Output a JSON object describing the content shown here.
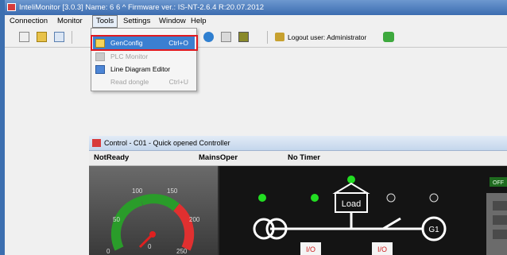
{
  "window": {
    "title": "InteliMonitor [3.0.3] Name: 6  6  ^   Firmware ver.: IS-NT-2.6.4 R:20.07.2012"
  },
  "menubar": {
    "items": [
      "Connection",
      "Monitor",
      "Tools",
      "Settings",
      "Window",
      "Help"
    ],
    "open_item": "Tools"
  },
  "toolbar": {
    "logout_label": "Logout user: Administrator"
  },
  "tools_menu": {
    "items": [
      {
        "label": "GenConfig",
        "shortcut": "Ctrl+O",
        "state": "highlighted",
        "icon": "genconfig-icon"
      },
      {
        "label": "PLC Monitor",
        "shortcut": "",
        "state": "disabled",
        "icon": "plc-monitor-icon"
      },
      {
        "label": "Line Diagram Editor",
        "shortcut": "",
        "state": "enabled",
        "icon": "line-diagram-icon"
      },
      {
        "label": "Read dongle",
        "shortcut": "Ctrl+U",
        "state": "disabled",
        "icon": ""
      }
    ]
  },
  "control_window": {
    "title": "Control - C01 - Quick opened Controller",
    "status": {
      "left": "NotReady",
      "middle": "MainsOper",
      "right": "No Timer"
    },
    "gauge": {
      "ticks": [
        "0",
        "50",
        "100",
        "150",
        "200",
        "250",
        "0"
      ]
    },
    "diagram": {
      "load_label": "Load",
      "generator_label": "G1",
      "io_label": "I/O",
      "side_label": "OFF"
    }
  },
  "colors": {
    "highlight_border": "#e0191f",
    "menu_highlight": "#3b7fd1",
    "led_green": "#22dd22"
  }
}
